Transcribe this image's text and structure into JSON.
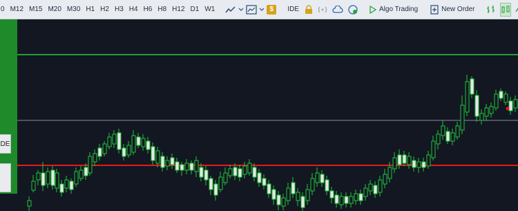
{
  "toolbar": {
    "timeframes": [
      "0",
      "M12",
      "M15",
      "M20",
      "M30",
      "H1",
      "H2",
      "H3",
      "H4",
      "H6",
      "H8",
      "H12",
      "D1",
      "W1"
    ],
    "ide_label": "IDE",
    "algo_trading_label": "Algo Trading",
    "new_order_label": "New Order",
    "icons": [
      "line-chart-icon",
      "chart-type-icon",
      "dollar-icon",
      "lock-icon",
      "signal-icon",
      "cloud-icon",
      "vps-icon",
      "play-icon",
      "new-order-icon",
      "bar-chart-icon",
      "candles-icon",
      "line-wave-icon",
      "zoom-in-icon"
    ]
  },
  "left_panel": {
    "ide_button_label": "DE",
    "second_button_label": ""
  },
  "colors": {
    "background": "#131722",
    "bull": "#21c43a",
    "bear": "#e6e6e6",
    "green_line": "#1fa32f",
    "red_line": "#e31b1b",
    "gray_line": "#8a8f99",
    "panel_green": "#1e8a2a"
  }
}
